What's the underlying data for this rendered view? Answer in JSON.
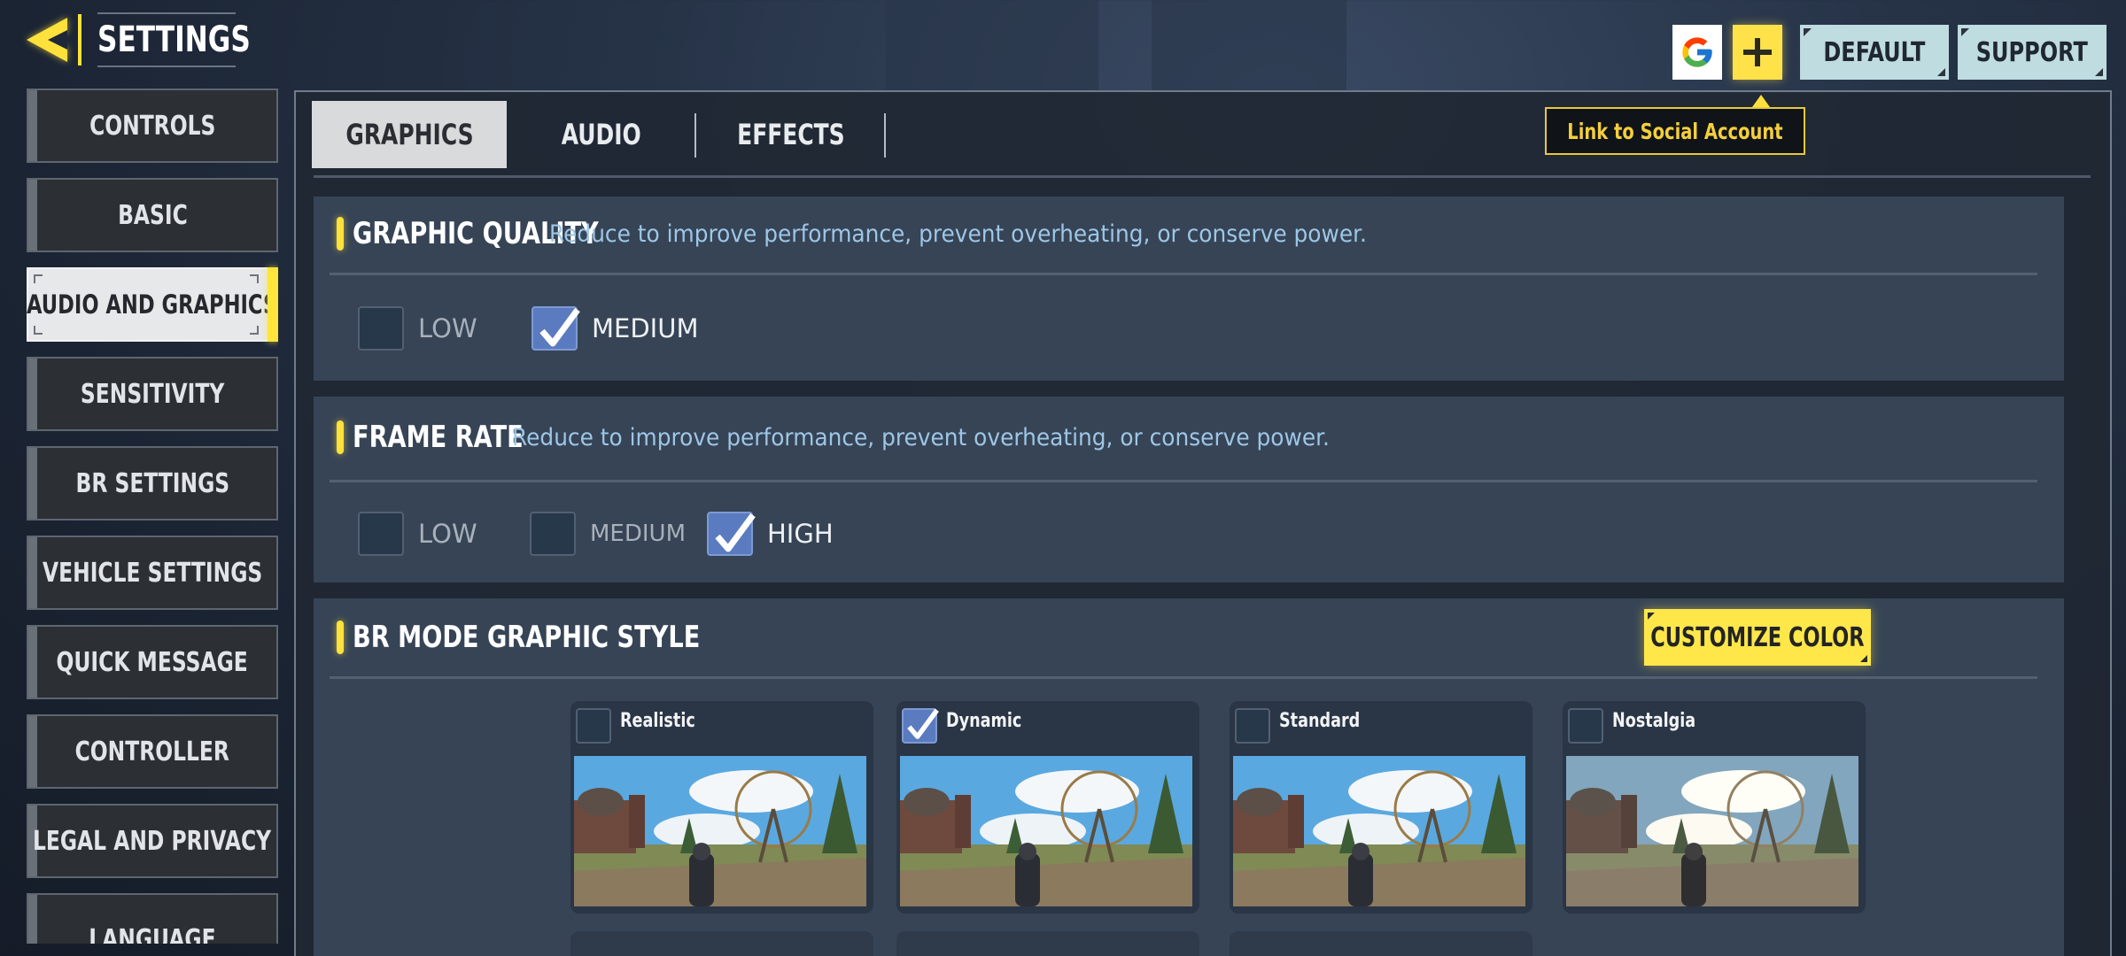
{
  "header": {
    "title": "SETTINGS",
    "back_icon": "back-arrow-icon"
  },
  "top_actions": {
    "google_icon": "google-logo-icon",
    "add_icon": "plus-icon",
    "default_label": "DEFAULT",
    "support_label": "SUPPORT",
    "tooltip": "Link to Social Account"
  },
  "sidebar": {
    "items": [
      {
        "label": "CONTROLS",
        "active": false
      },
      {
        "label": "BASIC",
        "active": false
      },
      {
        "label": "AUDIO AND GRAPHICS",
        "active": true
      },
      {
        "label": "SENSITIVITY",
        "active": false
      },
      {
        "label": "BR SETTINGS",
        "active": false
      },
      {
        "label": "VEHICLE SETTINGS",
        "active": false
      },
      {
        "label": "QUICK MESSAGE",
        "active": false
      },
      {
        "label": "CONTROLLER",
        "active": false
      },
      {
        "label": "LEGAL AND PRIVACY",
        "active": false
      },
      {
        "label": "LANGUAGE",
        "active": false
      }
    ]
  },
  "tabs": [
    {
      "label": "GRAPHICS",
      "active": true
    },
    {
      "label": "AUDIO",
      "active": false
    },
    {
      "label": "EFFECTS",
      "active": false
    }
  ],
  "graphic_quality": {
    "title": "GRAPHIC QUALITY",
    "description": "Reduce to improve performance, prevent overheating, or conserve power.",
    "options": [
      {
        "label": "LOW",
        "checked": false
      },
      {
        "label": "MEDIUM",
        "checked": true
      }
    ]
  },
  "frame_rate": {
    "title": "FRAME RATE",
    "description": "Reduce to improve performance, prevent overheating, or conserve power.",
    "options": [
      {
        "label": "LOW",
        "checked": false
      },
      {
        "label": "MEDIUM",
        "checked": false
      },
      {
        "label": "HIGH",
        "checked": true
      }
    ]
  },
  "br_style": {
    "title": "BR MODE GRAPHIC STYLE",
    "customize_label": "CUSTOMIZE COLOR",
    "styles": [
      {
        "name": "Realistic",
        "checked": false
      },
      {
        "name": "Dynamic",
        "checked": true
      },
      {
        "name": "Standard",
        "checked": false
      },
      {
        "name": "Nostalgia",
        "checked": false
      }
    ]
  },
  "colors": {
    "accent_yellow": "#ffe13b",
    "checkbox_checked": "#5a7bbf",
    "description_text": "#9ec6e5",
    "button_light": "#bfdce0"
  }
}
